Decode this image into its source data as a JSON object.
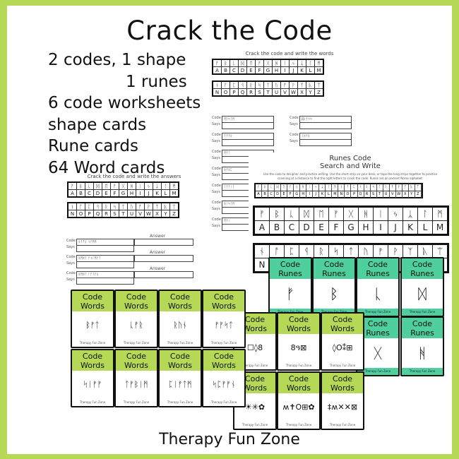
{
  "title": "Crack the Code",
  "features": [
    "2 codes, 1 shape",
    "1 runes",
    "6 code worksheets",
    "shape cards",
    "Rune cards",
    "64 Word cards"
  ],
  "brand": "Therapy Fun Zone",
  "key": {
    "letters_row1": [
      "A",
      "B",
      "C",
      "D",
      "E",
      "F",
      "G",
      "H",
      "I",
      "J",
      "K",
      "L",
      "M"
    ],
    "runes_row1": [
      "ᚠ",
      "ᛒ",
      "ᚳ",
      "ᛞ",
      "ᛖ",
      "ᚠ",
      "ᚷ",
      "ᚻ",
      "ᛁ",
      "ᛃ",
      "ᛣ",
      "ᛚ",
      "ᛗ"
    ],
    "letters_row2": [
      "N",
      "O",
      "P",
      "Q",
      "R",
      "S",
      "T",
      "U",
      "V",
      "W",
      "X",
      "Y",
      "Z"
    ],
    "runes_row2": [
      "ᚾ",
      "ᚩ",
      "ᛈ",
      "ᛩ",
      "ᚱ",
      "ᛋ",
      "ᛏ",
      "ᚢ",
      "ᚡ",
      "ᚹ",
      "ᛉ",
      "ᚣ",
      "ᛠ"
    ]
  },
  "worksheet_words": {
    "title": "Crack the code and write the words",
    "code_label": "Code",
    "says_label": "Says",
    "codes_left": [
      "ᛗᚢᛋᛚᛗ",
      "ᚠᚠᚠᚱ",
      "ᛗᚠᛏ",
      "ᚻᚠᛒᛈ",
      "ᛚᚠᚠᛁᛏ",
      "ᚻᛁᛋᛚᛗ",
      "ᛗᚠᛁ"
    ],
    "codes_right": [
      "ᛞᚱᚠᛋᛋ",
      "ᛚᚻᚠᛒ"
    ]
  },
  "worksheet_answers": {
    "title": "Crack the code and write the answers",
    "code_label": "Code",
    "says_label": "Says",
    "answer_label": "Answer",
    "codes": [
      "ᛒᚠᚩᚱ ᚾᚠᛗᛗ",
      "ᛒᛗᚻᛏ ᚠᚾᛚᛗᚠᛏ",
      "ᛒᛗᚻᛏ ᛚᚠᛏᚠᚱ"
    ]
  },
  "runes_sheet": {
    "title_line1": "Runes Code",
    "title_line2": "Search and Write",
    "instructions": "Use the code to decipher and practice writing. Use the short strip on your desk, or tape the long strips together to practice scanning at a distance to find the right letters to crack the code. Runes are an ancient Norse alphabet.",
    "partial_letter": "N"
  },
  "word_cards": {
    "header_line1": "Code",
    "header_line2": "Words",
    "footer": "Therapy Fun Zone",
    "symbols": [
      "ᛒᚠᛏ",
      "ᚳᚠᚱ",
      "ᚱᚢᚾ",
      "ᚠᚠᛋᛏ",
      "ᛋᛁᚠᚠ",
      "ᛏᚠᛒᛁᛗ",
      "ᛈᛁᚠᛏᛗ",
      "ᛋᛈᚠᚠᚾ"
    ]
  },
  "shape_cards": {
    "header_line1": "Code",
    "header_line2": "Words",
    "footer": "Therapy Fun Zone",
    "symbols": [
      "☐◊8",
      "8ዓ⊠",
      "◊O⁑⊞",
      "☀✳✿",
      "ʍ✝O⊞✿",
      "‡ʍ✕✕⊠"
    ]
  },
  "rune_cards": {
    "header_line1": "Code",
    "header_line2": "Runes",
    "footer": "Therapy Fun Zone",
    "symbols": [
      "ᚠ",
      "ᛒ",
      "ᚳ",
      "ᛞ",
      "ᚷ",
      "ᚻ"
    ]
  }
}
